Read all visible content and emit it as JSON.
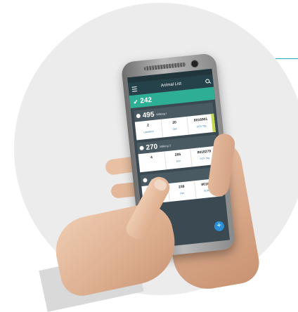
{
  "accent_color": "#2aa8c7",
  "app": {
    "title": "Animal List",
    "total": "242",
    "groups": [
      {
        "count": "495",
        "label": "Milking I",
        "stats": [
          {
            "value": "2",
            "label": "Lactation"
          },
          {
            "value": "20",
            "label": "Dim"
          },
          {
            "value": "8016901",
            "label": "SCR Tag"
          }
        ]
      },
      {
        "count": "270",
        "label": "Milking 3",
        "stats": [
          {
            "value": "4",
            "label": ""
          },
          {
            "value": "265",
            "label": "Dim"
          },
          {
            "value": "8018279",
            "label": "SCR Tag"
          }
        ]
      },
      {
        "count": "",
        "label": "Milking I",
        "stats": [
          {
            "value": "",
            "label": "Lactation"
          },
          {
            "value": "238",
            "label": "Dim"
          },
          {
            "value": "8016735",
            "label": "SCR Tag"
          }
        ]
      }
    ],
    "fab": "+"
  },
  "icons": {
    "menu": "menu-icon",
    "search": "search-icon",
    "cow": "cow-icon",
    "add": "plus-icon"
  }
}
